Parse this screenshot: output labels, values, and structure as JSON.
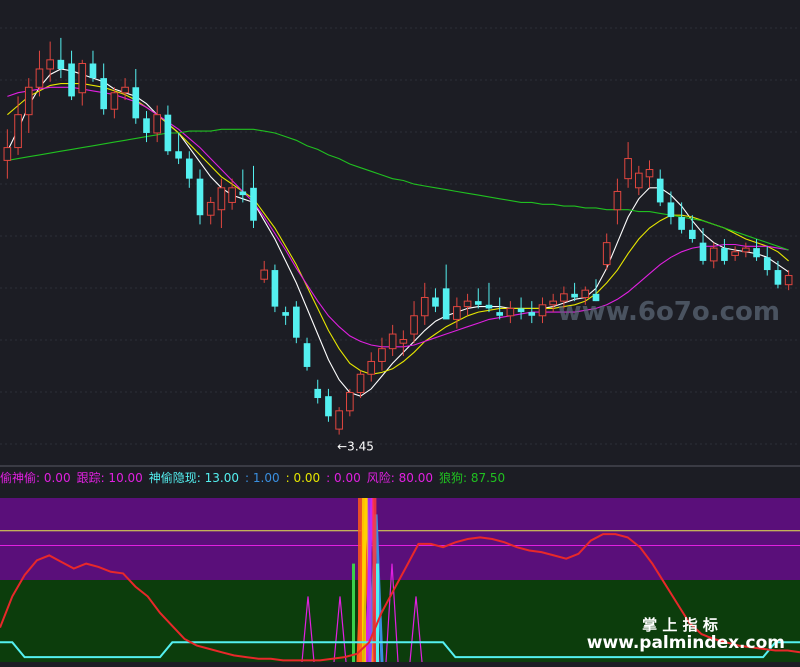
{
  "chart_data": [
    {
      "type": "candlestick",
      "title": "",
      "price_ylim": [
        3.3,
        5.8
      ],
      "low_label": "3.45",
      "colors": {
        "up": "#e0463f",
        "down": "#54f0f0",
        "background": "#1c1d24"
      },
      "candles": [
        {
          "o": 4.95,
          "h": 5.12,
          "l": 4.85,
          "c": 5.02
        },
        {
          "o": 5.02,
          "h": 5.3,
          "l": 4.98,
          "c": 5.2
        },
        {
          "o": 5.2,
          "h": 5.4,
          "l": 5.1,
          "c": 5.35
        },
        {
          "o": 5.35,
          "h": 5.55,
          "l": 5.3,
          "c": 5.45
        },
        {
          "o": 5.45,
          "h": 5.6,
          "l": 5.38,
          "c": 5.5
        },
        {
          "o": 5.5,
          "h": 5.62,
          "l": 5.4,
          "c": 5.45
        },
        {
          "o": 5.48,
          "h": 5.55,
          "l": 5.28,
          "c": 5.3
        },
        {
          "o": 5.32,
          "h": 5.5,
          "l": 5.25,
          "c": 5.48
        },
        {
          "o": 5.48,
          "h": 5.55,
          "l": 5.38,
          "c": 5.4
        },
        {
          "o": 5.4,
          "h": 5.48,
          "l": 5.2,
          "c": 5.23
        },
        {
          "o": 5.23,
          "h": 5.35,
          "l": 5.18,
          "c": 5.32
        },
        {
          "o": 5.32,
          "h": 5.4,
          "l": 5.28,
          "c": 5.35
        },
        {
          "o": 5.35,
          "h": 5.45,
          "l": 5.15,
          "c": 5.18
        },
        {
          "o": 5.18,
          "h": 5.22,
          "l": 5.05,
          "c": 5.1
        },
        {
          "o": 5.1,
          "h": 5.25,
          "l": 5.05,
          "c": 5.2
        },
        {
          "o": 5.2,
          "h": 5.25,
          "l": 4.98,
          "c": 5.0
        },
        {
          "o": 5.0,
          "h": 5.1,
          "l": 4.93,
          "c": 4.96
        },
        {
          "o": 4.96,
          "h": 5.0,
          "l": 4.8,
          "c": 4.85
        },
        {
          "o": 4.85,
          "h": 4.9,
          "l": 4.6,
          "c": 4.65
        },
        {
          "o": 4.65,
          "h": 4.75,
          "l": 4.6,
          "c": 4.72
        },
        {
          "o": 4.68,
          "h": 4.85,
          "l": 4.58,
          "c": 4.8
        },
        {
          "o": 4.72,
          "h": 4.85,
          "l": 4.68,
          "c": 4.8
        },
        {
          "o": 4.78,
          "h": 4.9,
          "l": 4.72,
          "c": 4.76
        },
        {
          "o": 4.8,
          "h": 4.92,
          "l": 4.58,
          "c": 4.62
        },
        {
          "o": 4.3,
          "h": 4.4,
          "l": 4.28,
          "c": 4.35
        },
        {
          "o": 4.35,
          "h": 4.38,
          "l": 4.12,
          "c": 4.15
        },
        {
          "o": 4.12,
          "h": 4.15,
          "l": 4.05,
          "c": 4.1
        },
        {
          "o": 4.15,
          "h": 4.18,
          "l": 3.95,
          "c": 3.98
        },
        {
          "o": 3.95,
          "h": 3.98,
          "l": 3.8,
          "c": 3.82
        },
        {
          "o": 3.7,
          "h": 3.75,
          "l": 3.62,
          "c": 3.65
        },
        {
          "o": 3.66,
          "h": 3.7,
          "l": 3.52,
          "c": 3.55
        },
        {
          "o": 3.48,
          "h": 3.6,
          "l": 3.45,
          "c": 3.58
        },
        {
          "o": 3.58,
          "h": 3.7,
          "l": 3.55,
          "c": 3.68
        },
        {
          "o": 3.68,
          "h": 3.8,
          "l": 3.65,
          "c": 3.78
        },
        {
          "o": 3.78,
          "h": 3.9,
          "l": 3.74,
          "c": 3.85
        },
        {
          "o": 3.85,
          "h": 3.98,
          "l": 3.8,
          "c": 3.92
        },
        {
          "o": 3.92,
          "h": 4.05,
          "l": 3.88,
          "c": 4.0
        },
        {
          "o": 3.95,
          "h": 4.02,
          "l": 3.88,
          "c": 3.97
        },
        {
          "o": 4.0,
          "h": 4.18,
          "l": 3.95,
          "c": 4.1
        },
        {
          "o": 4.1,
          "h": 4.28,
          "l": 4.05,
          "c": 4.2
        },
        {
          "o": 4.2,
          "h": 4.25,
          "l": 4.12,
          "c": 4.15
        },
        {
          "o": 4.25,
          "h": 4.38,
          "l": 4.2,
          "c": 4.08
        },
        {
          "o": 4.08,
          "h": 4.2,
          "l": 4.03,
          "c": 4.15
        },
        {
          "o": 4.15,
          "h": 4.22,
          "l": 4.1,
          "c": 4.18
        },
        {
          "o": 4.18,
          "h": 4.25,
          "l": 4.14,
          "c": 4.16
        },
        {
          "o": 4.16,
          "h": 4.28,
          "l": 4.12,
          "c": 4.14
        },
        {
          "o": 4.12,
          "h": 4.2,
          "l": 4.08,
          "c": 4.1
        },
        {
          "o": 4.1,
          "h": 4.18,
          "l": 4.06,
          "c": 4.14
        },
        {
          "o": 4.14,
          "h": 4.2,
          "l": 4.08,
          "c": 4.12
        },
        {
          "o": 4.12,
          "h": 4.18,
          "l": 4.06,
          "c": 4.1
        },
        {
          "o": 4.1,
          "h": 4.2,
          "l": 4.06,
          "c": 4.16
        },
        {
          "o": 4.16,
          "h": 4.22,
          "l": 4.12,
          "c": 4.18
        },
        {
          "o": 4.18,
          "h": 4.26,
          "l": 4.14,
          "c": 4.22
        },
        {
          "o": 4.22,
          "h": 4.28,
          "l": 4.18,
          "c": 4.2
        },
        {
          "o": 4.2,
          "h": 4.26,
          "l": 4.16,
          "c": 4.24
        },
        {
          "o": 4.22,
          "h": 4.3,
          "l": 4.18,
          "c": 4.18
        },
        {
          "o": 4.38,
          "h": 4.55,
          "l": 4.35,
          "c": 4.5
        },
        {
          "o": 4.68,
          "h": 4.85,
          "l": 4.6,
          "c": 4.78
        },
        {
          "o": 4.85,
          "h": 5.05,
          "l": 4.8,
          "c": 4.96
        },
        {
          "o": 4.8,
          "h": 4.92,
          "l": 4.76,
          "c": 4.88
        },
        {
          "o": 4.86,
          "h": 4.95,
          "l": 4.8,
          "c": 4.9
        },
        {
          "o": 4.85,
          "h": 4.9,
          "l": 4.7,
          "c": 4.72
        },
        {
          "o": 4.72,
          "h": 4.78,
          "l": 4.6,
          "c": 4.64
        },
        {
          "o": 4.64,
          "h": 4.72,
          "l": 4.55,
          "c": 4.57
        },
        {
          "o": 4.57,
          "h": 4.65,
          "l": 4.5,
          "c": 4.52
        },
        {
          "o": 4.5,
          "h": 4.58,
          "l": 4.38,
          "c": 4.4
        },
        {
          "o": 4.4,
          "h": 4.5,
          "l": 4.36,
          "c": 4.47
        },
        {
          "o": 4.47,
          "h": 4.52,
          "l": 4.38,
          "c": 4.4
        },
        {
          "o": 4.43,
          "h": 4.48,
          "l": 4.4,
          "c": 4.45
        },
        {
          "o": 4.45,
          "h": 4.5,
          "l": 4.42,
          "c": 4.47
        },
        {
          "o": 4.47,
          "h": 4.52,
          "l": 4.4,
          "c": 4.42
        },
        {
          "o": 4.42,
          "h": 4.48,
          "l": 4.32,
          "c": 4.35
        },
        {
          "o": 4.35,
          "h": 4.4,
          "l": 4.25,
          "c": 4.27
        },
        {
          "o": 4.27,
          "h": 4.35,
          "l": 4.24,
          "c": 4.32
        }
      ],
      "moving_averages": [
        {
          "color": "#ffffff",
          "values": [
            5.0,
            5.12,
            5.25,
            5.35,
            5.42,
            5.45,
            5.44,
            5.42,
            5.4,
            5.38,
            5.34,
            5.32,
            5.3,
            5.26,
            5.2,
            5.15,
            5.1,
            5.02,
            4.94,
            4.86,
            4.8,
            4.76,
            4.74,
            4.72,
            4.62,
            4.52,
            4.4,
            4.28,
            4.14,
            4.0,
            3.86,
            3.75,
            3.68,
            3.66,
            3.7,
            3.77,
            3.84,
            3.9,
            3.96,
            4.02,
            4.07,
            4.1,
            4.12,
            4.14,
            4.15,
            4.15,
            4.15,
            4.14,
            4.14,
            4.14,
            4.14,
            4.15,
            4.17,
            4.19,
            4.2,
            4.25,
            4.36,
            4.5,
            4.64,
            4.74,
            4.8,
            4.8,
            4.76,
            4.7,
            4.62,
            4.55,
            4.5,
            4.47,
            4.46,
            4.45,
            4.44,
            4.42,
            4.38,
            4.34
          ]
        },
        {
          "color": "#e6e600",
          "values": [
            5.2,
            5.25,
            5.3,
            5.33,
            5.36,
            5.37,
            5.37,
            5.37,
            5.36,
            5.35,
            5.33,
            5.31,
            5.28,
            5.24,
            5.2,
            5.15,
            5.1,
            5.04,
            4.98,
            4.92,
            4.86,
            4.82,
            4.78,
            4.74,
            4.66,
            4.58,
            4.48,
            4.38,
            4.26,
            4.14,
            4.02,
            3.92,
            3.84,
            3.8,
            3.78,
            3.79,
            3.81,
            3.85,
            3.9,
            3.96,
            4.0,
            4.04,
            4.07,
            4.1,
            4.12,
            4.13,
            4.14,
            4.14,
            4.14,
            4.14,
            4.14,
            4.14,
            4.15,
            4.16,
            4.18,
            4.22,
            4.28,
            4.35,
            4.44,
            4.52,
            4.58,
            4.62,
            4.65,
            4.65,
            4.64,
            4.62,
            4.6,
            4.58,
            4.55,
            4.52,
            4.5,
            4.48,
            4.45,
            4.4
          ]
        },
        {
          "color": "#e020e0",
          "values": [
            5.3,
            5.32,
            5.33,
            5.34,
            5.35,
            5.35,
            5.35,
            5.34,
            5.33,
            5.32,
            5.31,
            5.29,
            5.27,
            5.24,
            5.2,
            5.16,
            5.12,
            5.07,
            5.02,
            4.96,
            4.9,
            4.84,
            4.78,
            4.72,
            4.64,
            4.55,
            4.46,
            4.36,
            4.27,
            4.18,
            4.1,
            4.04,
            3.99,
            3.96,
            3.94,
            3.93,
            3.93,
            3.93,
            3.94,
            3.96,
            3.98,
            4.0,
            4.02,
            4.04,
            4.06,
            4.08,
            4.09,
            4.1,
            4.11,
            4.12,
            4.12,
            4.12,
            4.12,
            4.12,
            4.13,
            4.14,
            4.16,
            4.19,
            4.23,
            4.28,
            4.33,
            4.38,
            4.42,
            4.45,
            4.47,
            4.48,
            4.48,
            4.49,
            4.49,
            4.48,
            4.48,
            4.48,
            4.47,
            4.46
          ]
        },
        {
          "color": "#20c020",
          "values": [
            4.95,
            4.96,
            4.97,
            4.98,
            4.99,
            5.0,
            5.01,
            5.02,
            5.03,
            5.04,
            5.05,
            5.06,
            5.07,
            5.08,
            5.09,
            5.1,
            5.1,
            5.11,
            5.11,
            5.11,
            5.12,
            5.12,
            5.12,
            5.12,
            5.11,
            5.1,
            5.08,
            5.06,
            5.03,
            5.01,
            4.98,
            4.96,
            4.93,
            4.91,
            4.89,
            4.87,
            4.85,
            4.84,
            4.82,
            4.81,
            4.8,
            4.79,
            4.78,
            4.77,
            4.76,
            4.75,
            4.74,
            4.73,
            4.72,
            4.72,
            4.71,
            4.71,
            4.7,
            4.7,
            4.69,
            4.69,
            4.68,
            4.68,
            4.68,
            4.67,
            4.67,
            4.66,
            4.65,
            4.64,
            4.63,
            4.62,
            4.6,
            4.58,
            4.56,
            4.54,
            4.52,
            4.5,
            4.48,
            4.46
          ]
        }
      ]
    },
    {
      "type": "indicator",
      "indicator_labels": [
        {
          "text": "偷神偷: 0.00",
          "color": "#e020e0"
        },
        {
          "text": "跟踪: 10.00",
          "color": "#e020e0"
        },
        {
          "text": "神偷隐现: 13.00",
          "color": "#54f0f0"
        },
        {
          "text": ": 1.00",
          "color": "#3a8fe0"
        },
        {
          "text": ": 0.00",
          "color": "#e6e600"
        },
        {
          "text": ": 0.00",
          "color": "#e020e0"
        },
        {
          "text": "风险: 80.00",
          "color": "#e020e0"
        },
        {
          "text": "狼狗: 87.50",
          "color": "#20c020"
        }
      ],
      "ylim": [
        0,
        100
      ],
      "bands": [
        {
          "from": 80,
          "to": 100,
          "color": "#5a0f7a"
        },
        {
          "from": 50,
          "to": 80,
          "color": "#5a0f7a"
        },
        {
          "from": 0,
          "to": 50,
          "color": "#0c3d0c"
        }
      ],
      "reference_lines": [
        {
          "value": 80,
          "color": "#e6e650"
        },
        {
          "value": 71,
          "color": "#e020e0"
        }
      ],
      "red_line": [
        21,
        40,
        53,
        62,
        65,
        61,
        57,
        60,
        58,
        55,
        54,
        46,
        40,
        30,
        22,
        14,
        10,
        8,
        6,
        4,
        3,
        2,
        2,
        1,
        1,
        1,
        1,
        2,
        3,
        5,
        12,
        30,
        44,
        58,
        72,
        72,
        70,
        73,
        75,
        76,
        75,
        73,
        70,
        68,
        67,
        65,
        63,
        66,
        74,
        78,
        78,
        76,
        70,
        60,
        48,
        36,
        24,
        17,
        14,
        12,
        10,
        9,
        8,
        7,
        7,
        6
      ],
      "cyan_line": [
        12,
        12,
        3,
        3,
        3,
        3,
        3,
        3,
        3,
        3,
        3,
        3,
        3,
        3,
        12,
        12,
        12,
        12,
        12,
        12,
        12,
        12,
        12,
        12,
        12,
        12,
        12,
        12,
        12,
        12,
        12,
        12,
        12,
        12,
        12,
        12,
        12,
        3,
        3,
        3,
        3,
        3,
        3,
        3,
        3,
        3,
        3,
        3,
        3,
        3,
        3,
        3,
        3,
        3,
        3,
        3,
        3,
        3,
        3,
        3,
        3,
        3,
        3,
        12,
        12,
        12
      ],
      "spikes": [
        {
          "at": 0.385,
          "value": 40,
          "color": "#e020e0"
        },
        {
          "at": 0.425,
          "value": 40,
          "color": "#e020e0"
        },
        {
          "at": 0.455,
          "value": 100,
          "color": "#ff5a1a"
        },
        {
          "at": 0.458,
          "value": 100,
          "color": "#ffd000"
        },
        {
          "at": 0.465,
          "value": 100,
          "color": "#e020e0"
        },
        {
          "at": 0.47,
          "value": 90,
          "color": "#3a8fe0"
        },
        {
          "at": 0.49,
          "value": 60,
          "color": "#e020e0"
        },
        {
          "at": 0.52,
          "value": 40,
          "color": "#e020e0"
        }
      ]
    }
  ],
  "watermark_site": "www.6o7o.com",
  "watermark_cn": "掌 上 指 标",
  "watermark_url": "www.palmindex.com"
}
